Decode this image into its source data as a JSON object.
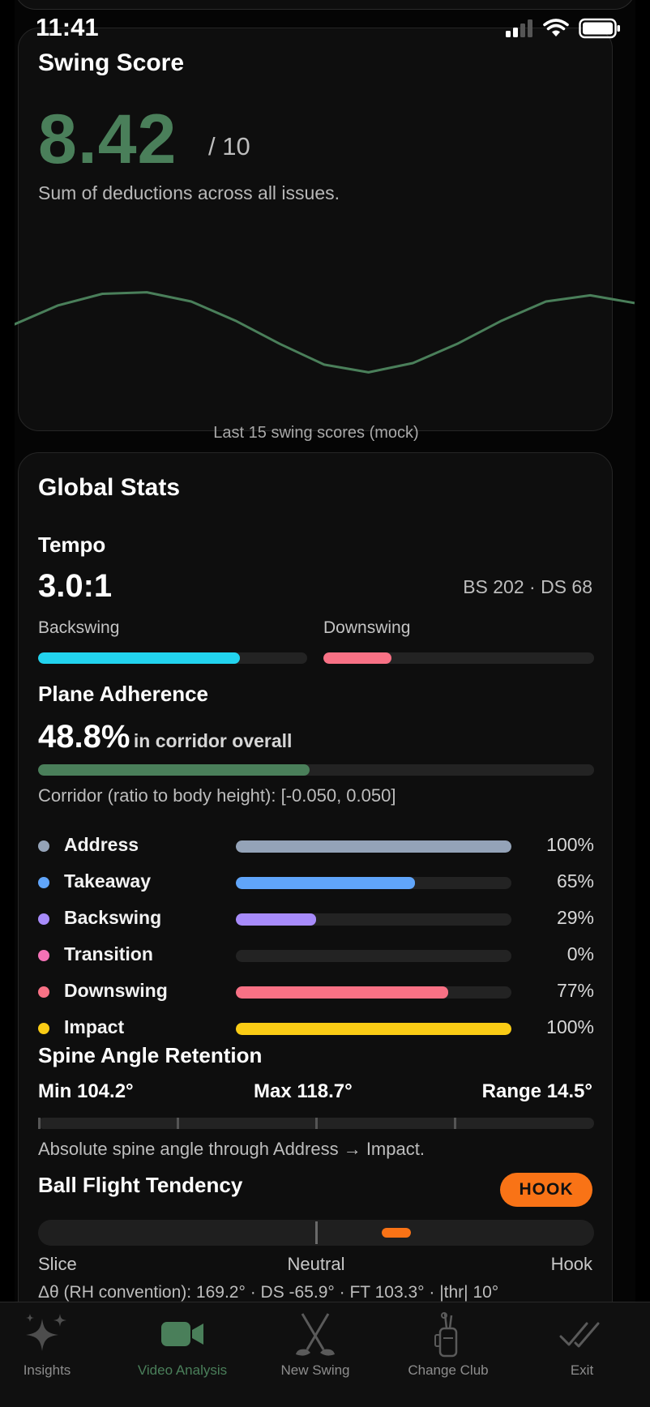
{
  "status": {
    "time": "11:41"
  },
  "swing_score": {
    "title": "Swing Score",
    "value": "8.42",
    "denominator": "/ 10",
    "subtitle": "Sum of deductions across all issues.",
    "chart_caption": "Last 15 swing scores (mock)",
    "color": "#4a7f5a"
  },
  "chart_data": {
    "type": "line",
    "title": "",
    "xlabel": "",
    "ylabel": "",
    "x": [
      1,
      2,
      3,
      4,
      5,
      6,
      7,
      8,
      9,
      10,
      11,
      12,
      13,
      14,
      15
    ],
    "y": [
      8.1,
      8.35,
      8.5,
      8.52,
      8.4,
      8.15,
      7.85,
      7.58,
      7.48,
      7.6,
      7.85,
      8.15,
      8.4,
      8.48,
      8.38
    ],
    "ylim": [
      7.0,
      9.0
    ],
    "grid": false,
    "color": "#4a7f5a"
  },
  "global_stats": {
    "title": "Global Stats",
    "tempo": {
      "label": "Tempo",
      "ratio": "3.0:1",
      "counts": "BS 202 · DS 68",
      "backswing_label": "Backswing",
      "downswing_label": "Downswing",
      "backswing_fill": 0.75,
      "downswing_fill": 0.25,
      "backswing_color": "#22d3ee",
      "downswing_color": "#f87185"
    },
    "plane": {
      "label": "Plane Adherence",
      "pct": "48.8%",
      "pct_suffix": "in corridor overall",
      "overall_fill": 0.488,
      "overall_color": "#4a7f5a",
      "corridor_text": "Corridor (ratio to body height): [-0.050, 0.050]",
      "phases": [
        {
          "name": "Address",
          "pct": "100%",
          "fill": 1.0,
          "color": "#94a3b8"
        },
        {
          "name": "Takeaway",
          "pct": "65%",
          "fill": 0.65,
          "color": "#60a5fa"
        },
        {
          "name": "Backswing",
          "pct": "29%",
          "fill": 0.29,
          "color": "#a78bfa"
        },
        {
          "name": "Transition",
          "pct": "0%",
          "fill": 0.0,
          "color": "#f472b6"
        },
        {
          "name": "Downswing",
          "pct": "77%",
          "fill": 0.77,
          "color": "#f87185"
        },
        {
          "name": "Impact",
          "pct": "100%",
          "fill": 1.0,
          "color": "#facc15"
        }
      ]
    },
    "spine": {
      "label": "Spine Angle Retention",
      "min": "Min 104.2°",
      "max": "Max 118.7°",
      "range": "Range 14.5°",
      "caption": "Absolute spine angle through Address → Impact."
    },
    "ball_flight": {
      "label": "Ball Flight Tendency",
      "badge": "HOOK",
      "badge_color": "#f97316",
      "left": "Slice",
      "center": "Neutral",
      "right": "Hook",
      "marker_position": 0.645,
      "detail": "Δθ (RH convention): 169.2° · DS -65.9° · FT 103.3° · |thr| 10°"
    }
  },
  "nav": {
    "items": [
      {
        "label": "Insights",
        "icon": "sparkles-icon",
        "active": false
      },
      {
        "label": "Video Analysis",
        "icon": "video-camera-icon",
        "active": true
      },
      {
        "label": "New Swing",
        "icon": "golf-clubs-icon",
        "active": false
      },
      {
        "label": "Change Club",
        "icon": "golf-bag-icon",
        "active": false
      },
      {
        "label": "Exit",
        "icon": "double-check-icon",
        "active": false
      }
    ],
    "active_color": "#4a7f5a",
    "inactive_color": "#8d8d8d"
  }
}
